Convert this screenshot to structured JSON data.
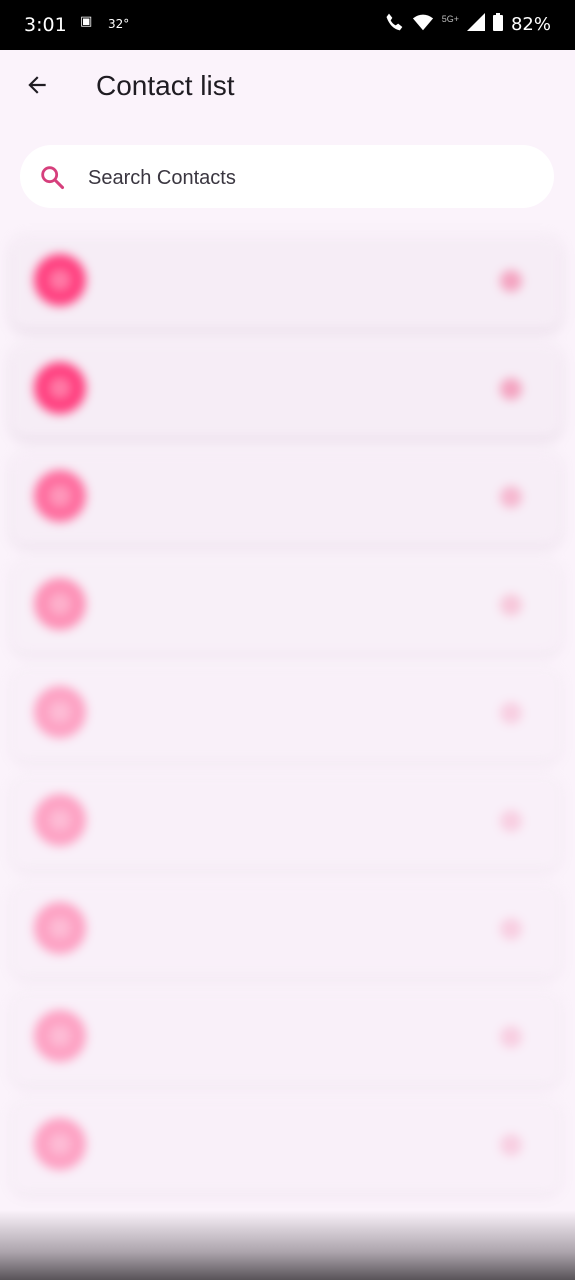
{
  "status_bar": {
    "time": "3:01",
    "temperature": "32°",
    "network_badge": "5G+",
    "battery": "82%"
  },
  "app_bar": {
    "title": "Contact list"
  },
  "search": {
    "placeholder": "Search Contacts"
  },
  "contacts": []
}
